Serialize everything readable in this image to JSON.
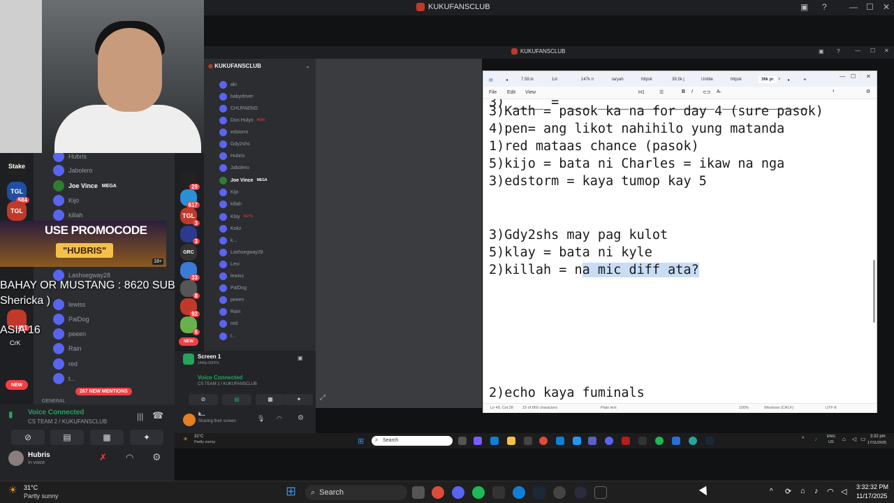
{
  "outer_window": {
    "title": "KUKUFANSCLUB"
  },
  "left_stream": {
    "server_badges": [
      "584",
      "29",
      "617",
      "491"
    ],
    "new_badge": "NEW",
    "members": [
      "Hubris",
      "Jabolero",
      "Joe Vince",
      "Kijo",
      "killah",
      "Lashsegway28",
      "lewiss",
      "PalDog",
      "peeen",
      "Rain",
      "red",
      "t..."
    ],
    "member_tag": "MEGA",
    "promo_line1": "USE PROMOCODE",
    "promo_line2": "\"HUBRIS\"",
    "promo_age": "18+",
    "overlay_line1": "BAHAY OR MUSTANG : 8620 SUBS",
    "overlay_line2": "Shericka )",
    "overlay_line3": "ASIA 16",
    "overlay_line4": "CrK",
    "mentions": "267 NEW MENTIONS",
    "section": "GENERAL",
    "voice_status": "Voice Connected",
    "voice_channel": "CS TEAM 2 / KUKUFANSCLUB",
    "user_name": "Hubris",
    "user_status": "In voice"
  },
  "inner_window": {
    "title": "KUKUFANSCLUB",
    "server_name": "KUKUFANSCLUB",
    "members": [
      "aki",
      "babydriver",
      "CHUPAENG",
      "Don Hulyo",
      "edstorm",
      "Gdy2shs",
      "Hubris",
      "Jabolero",
      "Joe Vince",
      "Kijo",
      "killah",
      "Klay",
      "Kokz",
      "k...",
      "Lashsegway28",
      "Levi",
      "lewiss",
      "PalDog",
      "peeen",
      "Rain",
      "red",
      "t..."
    ],
    "member_tags": [
      "AGKI",
      "MEGA",
      "KEYS"
    ],
    "server_badges": [
      "29",
      "617",
      "3",
      "3",
      "33",
      "8",
      "92",
      "6"
    ],
    "new_badge": "NEW",
    "screen_label": "Screen 1",
    "screen_sub": "1440p 60FPS",
    "voice_status": "Voice Connected",
    "voice_channel": "CS TEAM 2 / KUKUFANSCLUB",
    "user_name": "k...",
    "user_status": "Sharing their screen",
    "weather_temp": "31°C",
    "weather_desc": "Partly sunny",
    "search": "Search",
    "lang": "ENG",
    "lang2": "US",
    "time": "3:32 pm",
    "date": "17/11/2025"
  },
  "notepad": {
    "tabs": [
      "7.58.tx",
      "1st",
      "147k n",
      "taryah",
      "httpsk",
      "39.5k j",
      "Untitle",
      "httpsk",
      "36k pr"
    ],
    "menu": [
      "File",
      "Edit",
      "View"
    ],
    "heading_selector": "H1",
    "lines": [
      "3)Kath = pasok ka na for day 4 (sure pasok)",
      "4)pen= ang likot nahihilo yung matanda",
      "1)red mataas chance (pasok)",
      "5)kijo = bata ni Charles = ikaw na nga",
      "3)edstorm = kaya tumop kay 5",
      "",
      "",
      "3)Gdy2shs may pag kulot",
      "5)klay = bata ni kyle",
      "2)killah = na mic diff ata?",
      "",
      "",
      "",
      "",
      "",
      "",
      "2)echo kaya fuminals"
    ],
    "selected_text": "a mic diff ata?",
    "status": {
      "position": "Ln 49, Col 28",
      "chars": "15 of 860 characters",
      "format": "Plain text",
      "zoom": "100%",
      "eol": "Windows (CRLF)",
      "encoding": "UTF-8"
    }
  },
  "taskbar": {
    "weather_temp": "31°C",
    "weather_desc": "Partly sunny",
    "search": "Search",
    "time": "3:32:32 PM",
    "date": "11/17/2025"
  }
}
